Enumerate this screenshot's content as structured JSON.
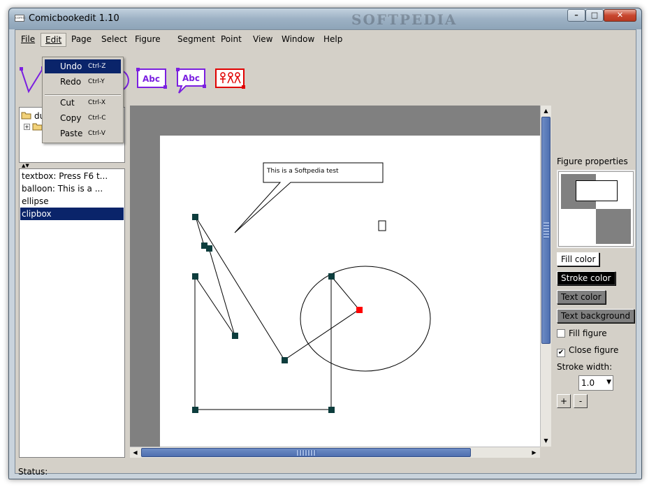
{
  "window": {
    "title": "Comicbookedit 1.10",
    "app_icon_label": "comic",
    "watermark": "SOFTPEDIA",
    "controls": {
      "minimize": "–",
      "maximize": "□",
      "close": "✕"
    }
  },
  "menubar": {
    "items": [
      {
        "label": "File"
      },
      {
        "label": "Edit"
      },
      {
        "label": "Page"
      },
      {
        "label": "Select"
      },
      {
        "label": "Figure"
      },
      {
        "label": "Segment"
      },
      {
        "label": "Point"
      },
      {
        "label": "View"
      },
      {
        "label": "Window"
      },
      {
        "label": "Help"
      }
    ],
    "active": "Edit"
  },
  "toolbar": {
    "icons": [
      {
        "name": "polyline-tool-icon",
        "color": "#7b1fe0"
      },
      {
        "name": "ellipse-tool-icon",
        "color": "#7b1fe0"
      },
      {
        "name": "textbox-tool-icon",
        "color": "#7b1fe0",
        "text": "Abc"
      },
      {
        "name": "balloon-tool-icon",
        "color": "#7b1fe0",
        "text": "Abc"
      },
      {
        "name": "clipbox-tool-icon",
        "color": "#e00000"
      }
    ]
  },
  "edit_menu": {
    "items": [
      {
        "label": "Undo",
        "shortcut": "Ctrl-Z",
        "selected": true
      },
      {
        "label": "Redo",
        "shortcut": "Ctrl-Y",
        "selected": false
      },
      {
        "label": "Cut",
        "shortcut": "Ctrl-X",
        "selected": false
      },
      {
        "label": "Copy",
        "shortcut": "Ctrl-C",
        "selected": false
      },
      {
        "label": "Paste",
        "shortcut": "Ctrl-V",
        "selected": false
      }
    ]
  },
  "tree": {
    "root_label": "du",
    "expand_symbol": "+"
  },
  "splitter_arrows": "▲▼",
  "figure_list": {
    "items": [
      {
        "label": "textbox: Press F6 t...",
        "selected": false
      },
      {
        "label": "balloon: This is a ...",
        "selected": false
      },
      {
        "label": "ellipse",
        "selected": false
      },
      {
        "label": "clipbox",
        "selected": true
      }
    ]
  },
  "canvas": {
    "balloon_text": "This is a Softpedia test"
  },
  "figure_properties": {
    "title": "Figure properties",
    "buttons": {
      "fill_color": "Fill color",
      "stroke_color": "Stroke color",
      "text_color": "Text color",
      "text_background": "Text background"
    },
    "fill_figure": {
      "label": "Fill figure",
      "checked": false
    },
    "close_figure": {
      "label": "Close figure",
      "checked": true,
      "mark": "✔"
    },
    "stroke_width_label": "Stroke width:",
    "stroke_width_value": "1.0",
    "plus": "+",
    "minus": "-"
  },
  "statusbar": {
    "label": "Status:"
  },
  "colors": {
    "selection": "#0a246a",
    "point_handle": "#0d3d3d",
    "active_point": "#ff0000",
    "stroke_color_button": "#000000",
    "text_color_button": "#808080"
  }
}
